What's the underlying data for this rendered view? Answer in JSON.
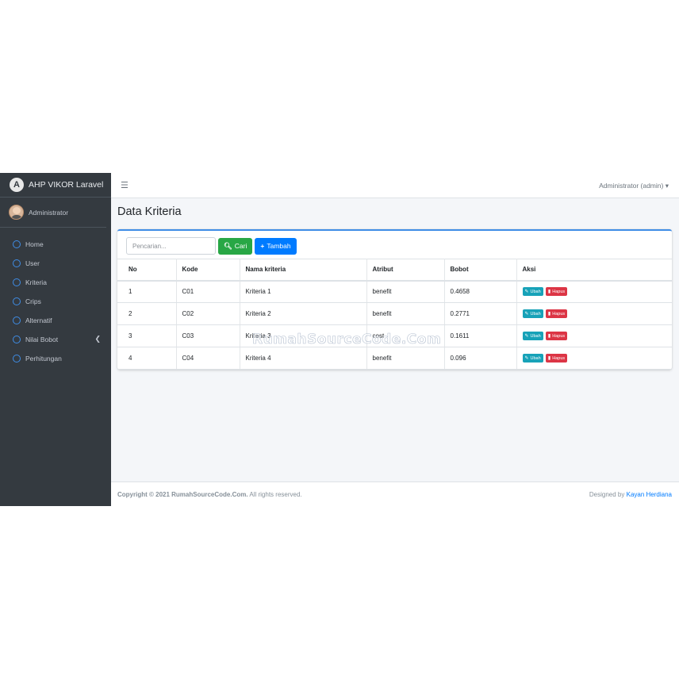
{
  "app": {
    "brand": "AHP VIKOR Laravel",
    "user": "Administrator"
  },
  "sidebar": {
    "items": [
      {
        "label": "Home"
      },
      {
        "label": "User"
      },
      {
        "label": "Kriteria"
      },
      {
        "label": "Crips"
      },
      {
        "label": "Alternatif"
      },
      {
        "label": "Nilai Bobot"
      },
      {
        "label": "Perhitungan"
      }
    ]
  },
  "topbar": {
    "menu_icon": "bars-icon",
    "user_menu": "Administrator (admin)",
    "caret": "▾"
  },
  "main": {
    "title": "Data Kriteria",
    "search_placeholder": "Pencarian...",
    "cari_label": "Cari",
    "tambah_label": "Tambah",
    "columns": [
      "No",
      "Kode",
      "Nama kriteria",
      "Atribut",
      "Bobot",
      "Aksi"
    ],
    "rows": [
      {
        "no": "1",
        "kode": "C01",
        "nama": "Kriteria 1",
        "atribut": "benefit",
        "bobot": "0.4658"
      },
      {
        "no": "2",
        "kode": "C02",
        "nama": "Kriteria 2",
        "atribut": "benefit",
        "bobot": "0.2771"
      },
      {
        "no": "3",
        "kode": "C03",
        "nama": "Kriteria 3",
        "atribut": "cost",
        "bobot": "0.1611"
      },
      {
        "no": "4",
        "kode": "C04",
        "nama": "Kriteria 4",
        "atribut": "benefit",
        "bobot": "0.096"
      }
    ],
    "ubah_label": "Ubah",
    "hapus_label": "Hapus"
  },
  "watermark": "RumahSourceCode.Com",
  "footer": {
    "copyright": "Copyright © 2021 RumahSourceCode.Com.",
    "rights": "All rights reserved.",
    "designed_by": "Designed by",
    "designer": "Kayan Herdiana"
  },
  "colors": {
    "sidebar": "#343a40",
    "accent": "#007bff",
    "success": "#28a745",
    "info": "#17a2b8",
    "danger": "#dc3545"
  }
}
